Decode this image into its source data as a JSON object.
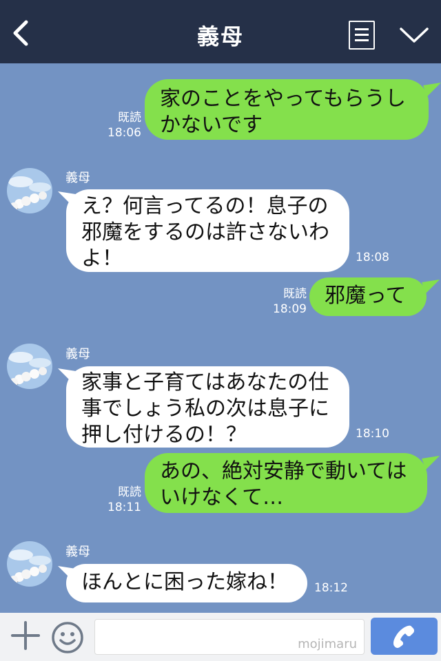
{
  "header": {
    "title": "義母"
  },
  "labels": {
    "read": "既読"
  },
  "messages": [
    {
      "type": "out",
      "text": "家のことをやってもらうしかないです",
      "lines": [
        "家のことをやってもらうし",
        "かないです"
      ],
      "time": "18:06"
    },
    {
      "type": "in",
      "sender": "義母",
      "text": "え？何言ってるの！息子の邪魔をするのは許さないわよ！",
      "lines": [
        "え？何言ってるの！息子の",
        "邪魔をするのは許さないわ",
        "よ！"
      ],
      "time": "18:08"
    },
    {
      "type": "out",
      "text": "邪魔って",
      "lines": [
        "邪魔って"
      ],
      "time": "18:09"
    },
    {
      "type": "in",
      "sender": "義母",
      "text": "家事と子育てはあなたの仕事でしょう私の次は息子に押し付けるの！？",
      "lines": [
        "家事と子育てはあなたの仕",
        "事でしょう私の次は息子に",
        "押し付けるの！？"
      ],
      "time": "18:10"
    },
    {
      "type": "out",
      "text": "あの、絶対安静で動いてはいけなくて…",
      "lines": [
        "あの、絶対安静で動いては",
        "いけなくて…"
      ],
      "time": "18:11"
    },
    {
      "type": "in",
      "sender": "義母",
      "text": "ほんとに困った嫁ね！",
      "lines": [
        "ほんとに困った嫁ね！"
      ],
      "time": "18:12"
    }
  ],
  "footer": {
    "watermark": "mojimaru"
  },
  "colors": {
    "header_bg": "#253048",
    "chat_bg": "#7393c3",
    "out_bubble": "#84e04c",
    "in_bubble": "#ffffff",
    "call_button": "#5b8bde"
  },
  "icons": {
    "back": "chevron-left-icon",
    "menu": "menu-icon",
    "collapse": "chevron-down-icon",
    "add": "plus-icon",
    "emoji": "smiley-icon",
    "call": "phone-icon"
  }
}
